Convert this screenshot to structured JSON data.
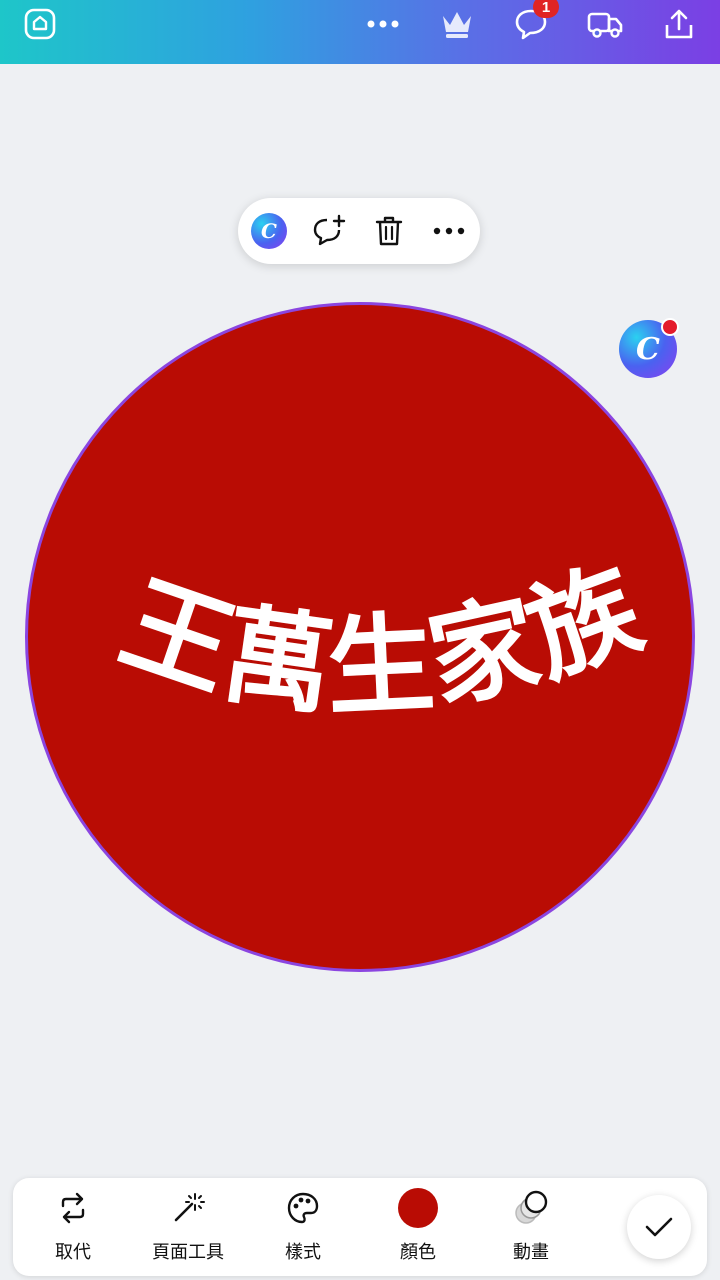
{
  "topbar": {
    "notification_count": "1",
    "icons": [
      "home-icon",
      "more-icon",
      "crown-icon",
      "comment-icon",
      "delivery-truck-icon",
      "share-icon"
    ]
  },
  "floating_toolbar": {
    "logo_letter": "C",
    "icons": [
      "canva-assistant-icon",
      "add-comment-icon",
      "trash-icon",
      "more-icon"
    ]
  },
  "design": {
    "text": "王萬生家族",
    "fill_color": "#b90c04",
    "text_color": "#ffffff"
  },
  "assistant": {
    "logo_letter": "C"
  },
  "bottom_toolbar": {
    "items": [
      {
        "label": "取代",
        "icon": "replace-icon"
      },
      {
        "label": "頁面工具",
        "icon": "magic-wand-icon"
      },
      {
        "label": "樣式",
        "icon": "palette-icon"
      },
      {
        "label": "顏色",
        "icon": "color-swatch"
      },
      {
        "label": "動畫",
        "icon": "animation-icon"
      }
    ],
    "done_icon": "checkmark-icon"
  },
  "colors": {
    "accent": "#7b3fe4",
    "selection_border": "#8b45e0"
  }
}
